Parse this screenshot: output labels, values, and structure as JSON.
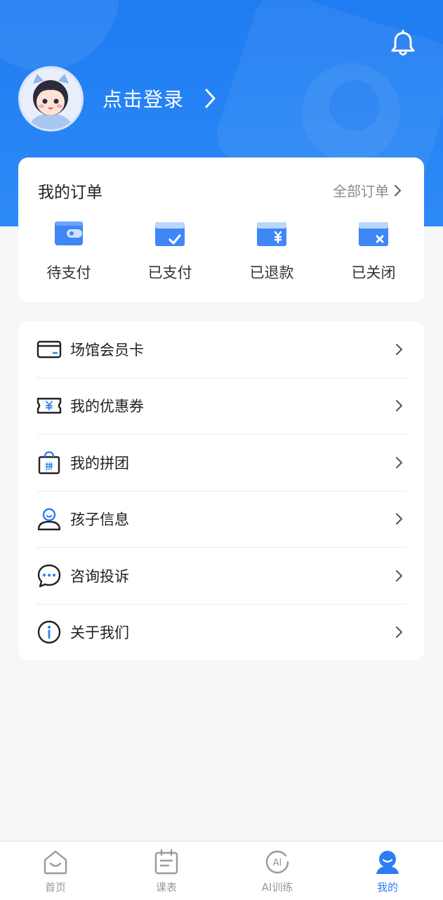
{
  "header": {
    "login_label": "点击登录"
  },
  "orders": {
    "title": "我的订单",
    "all_label": "全部订单",
    "items": [
      {
        "label": "待支付",
        "icon": "wallet-icon"
      },
      {
        "label": "已支付",
        "icon": "card-check-icon"
      },
      {
        "label": "已退款",
        "icon": "card-refund-icon"
      },
      {
        "label": "已关闭",
        "icon": "card-closed-icon"
      }
    ]
  },
  "menu": [
    {
      "label": "场馆会员卡",
      "icon": "membership-card-icon"
    },
    {
      "label": "我的优惠券",
      "icon": "coupon-icon"
    },
    {
      "label": "我的拼团",
      "icon": "group-buy-bag-icon"
    },
    {
      "label": "孩子信息",
      "icon": "child-user-icon"
    },
    {
      "label": "咨询投诉",
      "icon": "chat-bubble-icon"
    },
    {
      "label": "关于我们",
      "icon": "info-icon"
    }
  ],
  "tabbar": [
    {
      "label": "首页",
      "icon": "home-icon",
      "active": false
    },
    {
      "label": "课表",
      "icon": "schedule-icon",
      "active": false
    },
    {
      "label": "AI训练",
      "icon": "ai-training-icon",
      "active": false
    },
    {
      "label": "我的",
      "icon": "profile-icon",
      "active": true
    }
  ],
  "colors": {
    "brand_blue": "#1f7cf2",
    "tab_active": "#2b7df5",
    "page_bg": "#f5f6f8"
  }
}
